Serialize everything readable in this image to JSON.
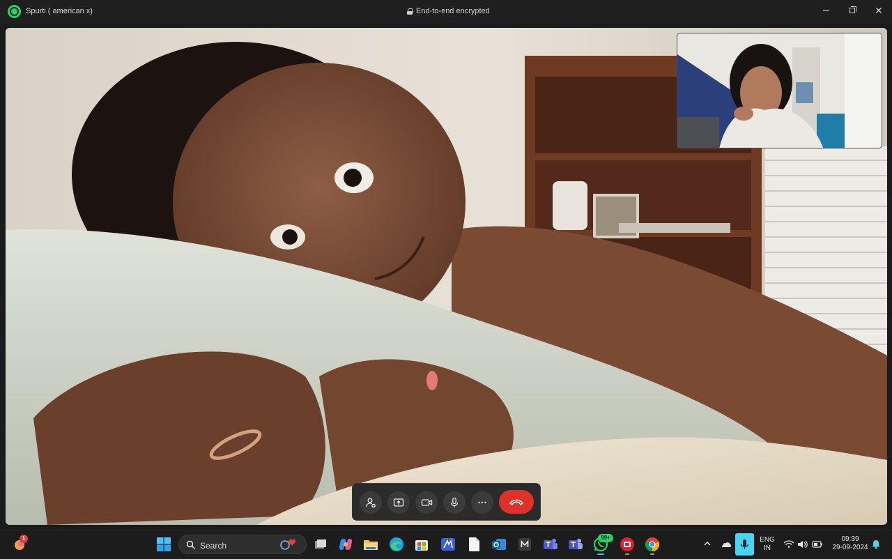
{
  "window": {
    "title": "Spurti ( american x)",
    "encryption_text": "End-to-end encrypted"
  },
  "call_controls": [
    {
      "name": "add-participant-button",
      "icon": "add-person-icon"
    },
    {
      "name": "share-screen-button",
      "icon": "share-screen-icon"
    },
    {
      "name": "video-toggle-button",
      "icon": "video-camera-icon"
    },
    {
      "name": "microphone-button",
      "icon": "microphone-icon"
    },
    {
      "name": "more-options-button",
      "icon": "more-horizontal-icon"
    },
    {
      "name": "end-call-button",
      "icon": "hang-up-icon",
      "color": "#e0302a"
    }
  ],
  "taskbar": {
    "widgets_badge": "1",
    "search_placeholder": "Search",
    "whatsapp_badge": "99+",
    "language_line1": "ENG",
    "language_line2": "IN",
    "time": "09:39",
    "date": "29-09-2024",
    "apps": [
      "start-icon",
      "task-view-icon",
      "copilot-icon",
      "file-explorer-icon",
      "edge-icon",
      "microsoft-store-icon",
      "app-icon",
      "notepad-icon",
      "outlook-icon",
      "app-m-icon",
      "teams-icon",
      "teams-work-icon",
      "whatsapp-icon",
      "app-red-icon",
      "chrome-icon"
    ]
  },
  "colors": {
    "titlebar": "#1f1f1f",
    "taskbar": "#1c1c1c",
    "whatsapp_green": "#25d366",
    "end_call_red": "#e0302a"
  }
}
